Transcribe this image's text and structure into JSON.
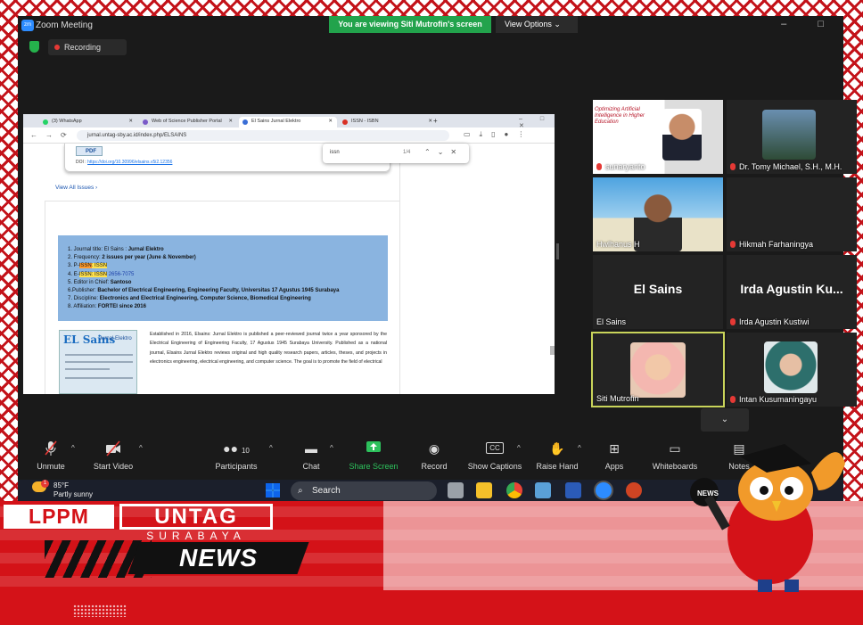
{
  "window": {
    "title": "Zoom Meeting",
    "sharing_banner": "You are viewing Siti Mutrofin's screen",
    "view_options": "View Options",
    "recording": "Recording"
  },
  "browser": {
    "tabs": [
      {
        "label": "(3) WhatsApp",
        "color": "#25d366"
      },
      {
        "label": "Web of Science Publisher Portal",
        "color": "#7a5ac8"
      },
      {
        "label": "El Sains Jurnal Elektro",
        "color": "#3a6ed6"
      },
      {
        "label": "ISSN - ISBN",
        "color": "#d93025"
      }
    ],
    "url": "jurnal.untag-sby.ac.id/index.php/ELSAINS",
    "find": {
      "query": "issn",
      "count": "1/4"
    },
    "pdf_label": "PDF",
    "doi_label": "DOI :",
    "doi_link": "https://doi.org/10.30996/elsains.v5i2.12356",
    "view_all": "View All Issues",
    "info": {
      "line1_prefix": "1. Journal title: El Sains : ",
      "line1_bold": "Jurnal Elektro",
      "line2_prefix": "2. Frequency: ",
      "line2_bold": "2 issues per year (June & November)",
      "line3_prefix": "3. P-",
      "line3_hl": "ISSN",
      "line3_rest": ": ISSN",
      "line3_num": "",
      "line4_prefix": "4. E-",
      "line4_hl": "ISSN",
      "line4_rest": ": ISSN",
      "line4_num": "2656-7075",
      "line5_prefix": "5. Editor in Chief: ",
      "line5_bold": "Santoso",
      "line6_prefix": "6.Publisher: ",
      "line6_bold": "Bachelor of Electrical Engineering, Engineering Faculty, Universitas 17 Agustus 1945 Surabaya",
      "line7_prefix": "7. Discipline: ",
      "line7_bold": "Electronics and Electrical Engineering, Computer Science, Biomedical Engineering",
      "line8_prefix": "8. Affiliation: ",
      "line8_bold": "FORTEI since 2016"
    },
    "thumb_title": "EL Sains",
    "thumb_sub": "Jurnal Elektro",
    "paragraph": "Established in 2016, Elsains: Jurnal Elektro is published a peer-reviewed journal twice a year sponsored by the Electrical Engineering of Engineering Faculty, 17 Agustus 1945 Surabaya University. Published as a national journal, Elsains Jurnal Elektro reviews original and high quality research papers, articles, theses, and projects in electronics engineering, electrical engineering, and computer science. The goal is to promote the field of electrical"
  },
  "participants": [
    {
      "name": "sunaryanto",
      "muted": true,
      "slide_title": "Optimizing Artificial Intelligence in Higher Education"
    },
    {
      "name": "Dr. Tomy Michael, S.H., M.H.",
      "muted": true
    },
    {
      "name": "Hwlhanus H",
      "muted": false
    },
    {
      "name": "Hikmah Farhaningya",
      "muted": true
    },
    {
      "name": "El Sains",
      "muted": false,
      "initials": "El Sains"
    },
    {
      "name": "Irda Agustin Kustiwi",
      "muted": true,
      "initials": "Irda Agustin Ku..."
    },
    {
      "name": "Siti Mutrofin",
      "muted": false
    },
    {
      "name": "Intan Kusumaningayu",
      "muted": true
    }
  ],
  "toolbar": [
    {
      "label": "Unmute",
      "icon": "mic-off-icon",
      "glyph": "🎙"
    },
    {
      "label": "Start Video",
      "icon": "video-off-icon",
      "glyph": "▣"
    },
    {
      "label": "Participants",
      "icon": "people-icon",
      "glyph": "👥",
      "badge": "10"
    },
    {
      "label": "Chat",
      "icon": "chat-icon",
      "glyph": "💬"
    },
    {
      "label": "Share Screen",
      "icon": "share-icon",
      "glyph": "⬆"
    },
    {
      "label": "Record",
      "icon": "record-icon",
      "glyph": "◉"
    },
    {
      "label": "Show Captions",
      "icon": "captions-icon",
      "glyph": "CC"
    },
    {
      "label": "Raise Hand",
      "icon": "hand-icon",
      "glyph": "✋"
    },
    {
      "label": "Apps",
      "icon": "apps-icon",
      "glyph": "⊞"
    },
    {
      "label": "Whiteboards",
      "icon": "whiteboard-icon",
      "glyph": "▭"
    },
    {
      "label": "Notes",
      "icon": "notes-icon",
      "glyph": "📝"
    }
  ],
  "taskbar": {
    "temp": "85°F",
    "weather": "Partly sunny",
    "search": "Search",
    "weather_badge": "1"
  },
  "branding": {
    "lppm": "LPPM",
    "untag": "UNTAG",
    "surabaya": "SURABAYA",
    "news": "NEWS",
    "mascot_mic": "NEWS"
  },
  "colors": {
    "brand_red": "#d41218",
    "zoom_green": "#22a34c",
    "speaker_border": "#c9d45a"
  }
}
